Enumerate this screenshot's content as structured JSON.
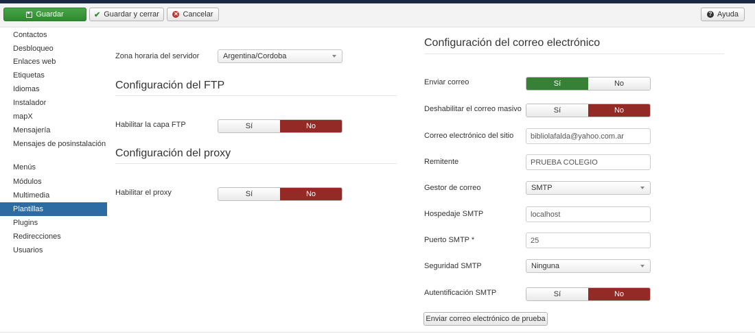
{
  "toolbar": {
    "save_label": "Guardar",
    "save_close_label": "Guardar y cerrar",
    "cancel_label": "Cancelar",
    "help_label": "Ayuda"
  },
  "sidebar": {
    "items": [
      {
        "label": "Contactos"
      },
      {
        "label": "Desbloqueo"
      },
      {
        "label": "Enlaces web"
      },
      {
        "label": "Etiquetas"
      },
      {
        "label": "Idiomas"
      },
      {
        "label": "Instalador"
      },
      {
        "label": "mapX"
      },
      {
        "label": "Mensajería"
      },
      {
        "label": "Mensajes de posinstalación"
      },
      {
        "label": "Menús"
      },
      {
        "label": "Módulos"
      },
      {
        "label": "Multimedia"
      },
      {
        "label": "Plantillas",
        "active": true
      },
      {
        "label": "Plugins"
      },
      {
        "label": "Redirecciones"
      },
      {
        "label": "Usuarios"
      }
    ]
  },
  "server": {
    "timezone_label": "Zona horaria del servidor",
    "timezone_value": "Argentina/Cordoba"
  },
  "ftp": {
    "title": "Configuración del FTP",
    "enable_label": "Habilitar la capa FTP",
    "yes": "Sí",
    "no": "No",
    "selected": "No"
  },
  "proxy": {
    "title": "Configuración del proxy",
    "enable_label": "Habilitar el proxy",
    "yes": "Sí",
    "no": "No",
    "selected": "No"
  },
  "mail": {
    "title": "Configuración del correo electrónico",
    "send_label": "Enviar correo",
    "send_yes": "Sí",
    "send_no": "No",
    "send_selected": "Sí",
    "mass_label": "Deshabilitar el correo masivo",
    "mass_yes": "Sí",
    "mass_no": "No",
    "mass_selected": "No",
    "site_email_label": "Correo electrónico del sitio",
    "site_email_value": "bibliolafalda@yahoo.com.ar",
    "sender_label": "Remitente",
    "sender_value": "PRUEBA COLEGIO",
    "mailer_label": "Gestor de correo",
    "mailer_value": "SMTP",
    "smtp_host_label": "Hospedaje SMTP",
    "smtp_host_value": "localhost",
    "smtp_port_label": "Puerto SMTP *",
    "smtp_port_value": "25",
    "smtp_security_label": "Seguridad SMTP",
    "smtp_security_value": "Ninguna",
    "smtp_auth_label": "Autentificación SMTP",
    "smtp_auth_yes": "Sí",
    "smtp_auth_no": "No",
    "smtp_auth_selected": "No",
    "test_button": "Enviar correo electrónico de prueba"
  },
  "colors": {
    "save_green": "#378137",
    "no_red": "#942a25",
    "active_blue": "#2d6ca2",
    "topbar": "#1a2a44"
  }
}
